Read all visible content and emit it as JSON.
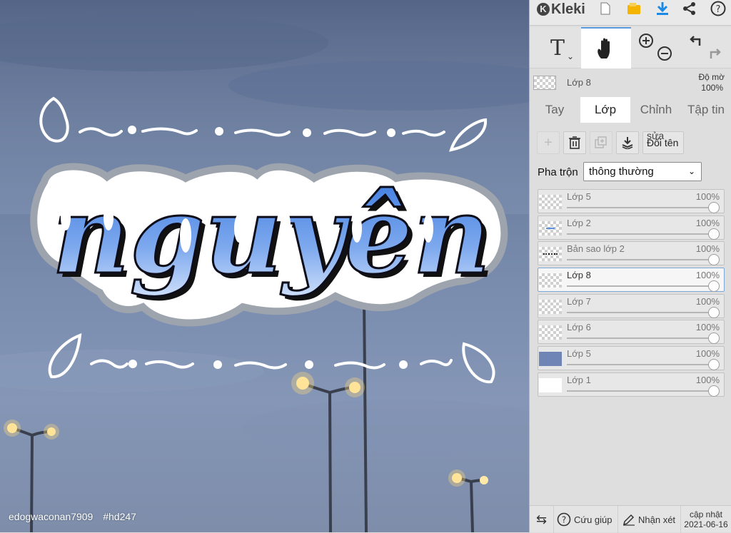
{
  "app": {
    "name": "Kleki",
    "icons": [
      "new-image-icon",
      "save-icon",
      "download-icon",
      "share-icon",
      "help-icon"
    ],
    "accent": "#1a8ae6"
  },
  "canvas": {
    "artwork_text": "nguyên",
    "watermark_user": "edogwaconan7909",
    "watermark_tag": "#hd247"
  },
  "tools": {
    "text_glyph": "T",
    "active_tool": "hand-tool",
    "icons": [
      "text-tool-icon",
      "hand-icon",
      "zoom-in-icon",
      "zoom-out-icon",
      "undo-icon",
      "redo-icon"
    ]
  },
  "current_layer": {
    "name": "Lớp 8",
    "opacity_label": "Độ mờ",
    "opacity_value": "100%"
  },
  "tabs": [
    {
      "label": "Tay",
      "active": false
    },
    {
      "label": "Lớp",
      "active": true
    },
    {
      "label": "Chỉnh",
      "active": false
    },
    {
      "label": "Tập tin",
      "active": false
    }
  ],
  "layer_actions": {
    "rename_label": "Đổi tên",
    "rename_overlay": "sửa"
  },
  "blend": {
    "label": "Pha trộn",
    "value": "thông thường"
  },
  "layers": [
    {
      "name": "Lớp 5",
      "opacity": "100%",
      "selected": false
    },
    {
      "name": "Lớp 2",
      "opacity": "100%",
      "selected": false
    },
    {
      "name": "Bản sao lớp 2",
      "opacity": "100%",
      "selected": false
    },
    {
      "name": "Lớp 8",
      "opacity": "100%",
      "selected": true
    },
    {
      "name": "Lớp 7",
      "opacity": "100%",
      "selected": false
    },
    {
      "name": "Lớp 6",
      "opacity": "100%",
      "selected": false
    },
    {
      "name": "Lớp 5",
      "opacity": "100%",
      "selected": false
    },
    {
      "name": "Lớp 1",
      "opacity": "100%",
      "selected": false
    }
  ],
  "bottom": {
    "help_label": "Cứu giúp",
    "feedback_label": "Nhận xét",
    "update_label": "cập nhật",
    "update_date": "2021-06-16"
  }
}
